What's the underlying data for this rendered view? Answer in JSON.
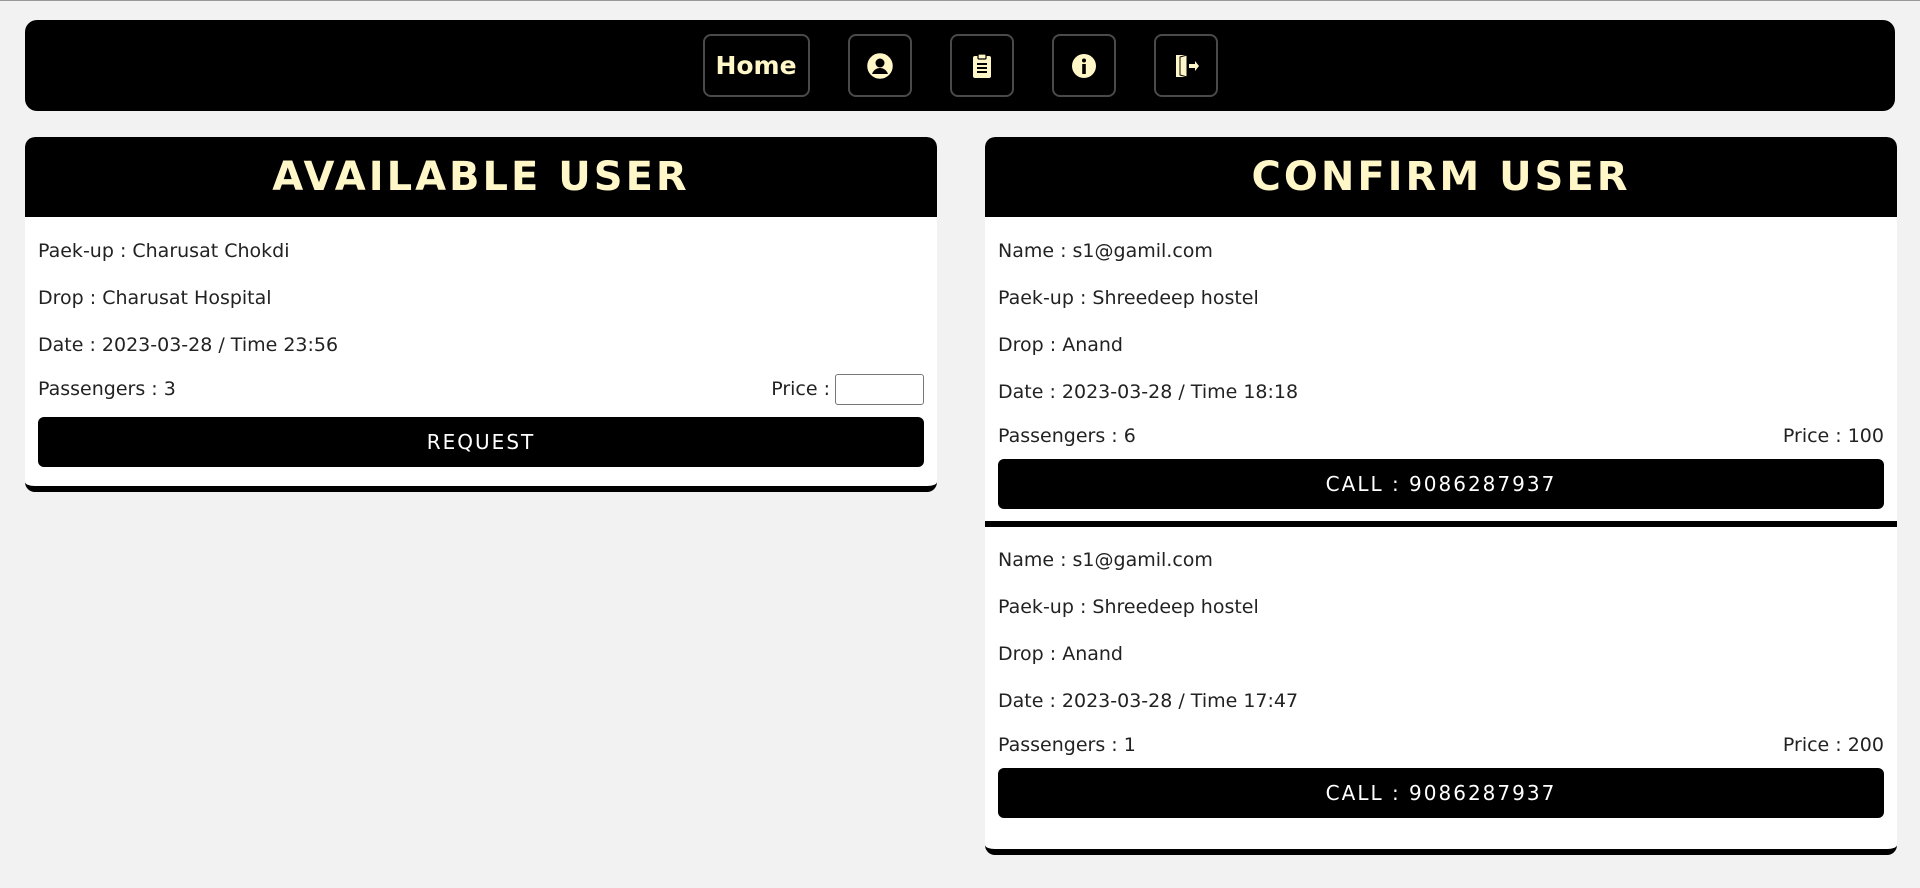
{
  "nav": {
    "home_label": "Home",
    "icons": [
      "user-circle-icon",
      "clipboard-icon",
      "info-icon",
      "logout-icon"
    ],
    "accent": "#fff7c8"
  },
  "available": {
    "title": "AVAILABLE USER",
    "pickup": "Paek-up : Charusat Chokdi",
    "drop": "Drop : Charusat Hospital",
    "datetime": "Date : 2023-03-28 / Time 23:56",
    "passengers": "Passengers : 3",
    "price_label": "Price :",
    "price_value": "",
    "request_label": "REQUEST"
  },
  "confirm": {
    "title": "CONFIRM USER",
    "entries": [
      {
        "name": "Name : s1@gamil.com",
        "pickup": "Paek-up : Shreedeep hostel",
        "drop": "Drop : Anand",
        "datetime": "Date : 2023-03-28 / Time 18:18",
        "passengers": "Passengers : 6",
        "price": "Price : 100",
        "call_label": "CALL : 9086287937"
      },
      {
        "name": "Name : s1@gamil.com",
        "pickup": "Paek-up : Shreedeep hostel",
        "drop": "Drop : Anand",
        "datetime": "Date : 2023-03-28 / Time 17:47",
        "passengers": "Passengers : 1",
        "price": "Price : 200",
        "call_label": "CALL : 9086287937"
      }
    ]
  }
}
